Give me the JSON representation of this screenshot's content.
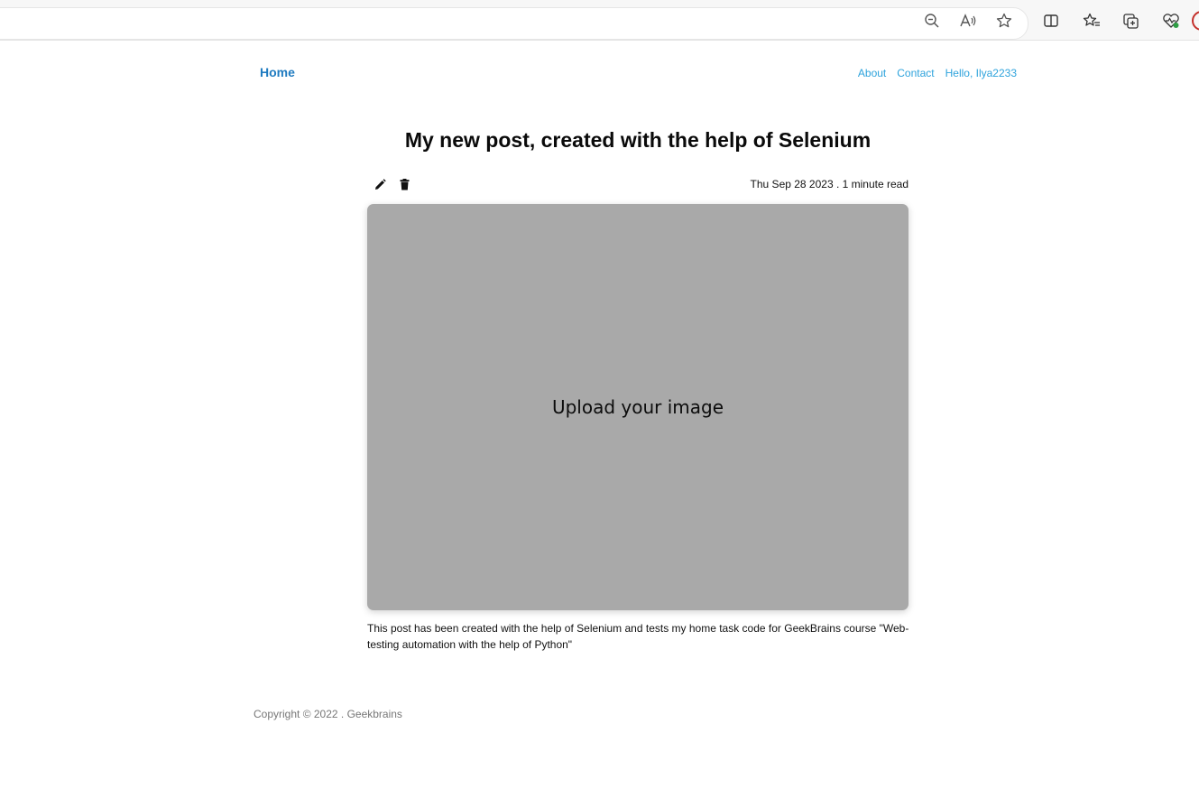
{
  "browser": {
    "icons": [
      "zoom-out-icon",
      "read-aloud-icon",
      "favorite-star-icon",
      "split-screen-icon",
      "favorites-icon",
      "collections-icon",
      "browser-essentials-icon",
      "profile-icon"
    ]
  },
  "nav": {
    "home": "Home",
    "about": "About",
    "contact": "Contact",
    "greeting": "Hello, Ilya2233"
  },
  "post": {
    "title": "My new post, created with the help of Selenium",
    "meta": "Thu Sep 28 2023 . 1 minute read",
    "image_placeholder": "Upload your image",
    "body": "This post has been created with the help of Selenium and tests my home task code for GeekBrains course \"Web-testing automation with the help of Python\"",
    "actions": [
      "edit-icon",
      "delete-icon"
    ]
  },
  "footer": {
    "copyright": "Copyright © 2022 . Geekbrains"
  },
  "colors": {
    "home_link": "#1f7bc0",
    "nav_link": "#2ea3dc",
    "image_placeholder_bg": "#a9a9a9"
  }
}
